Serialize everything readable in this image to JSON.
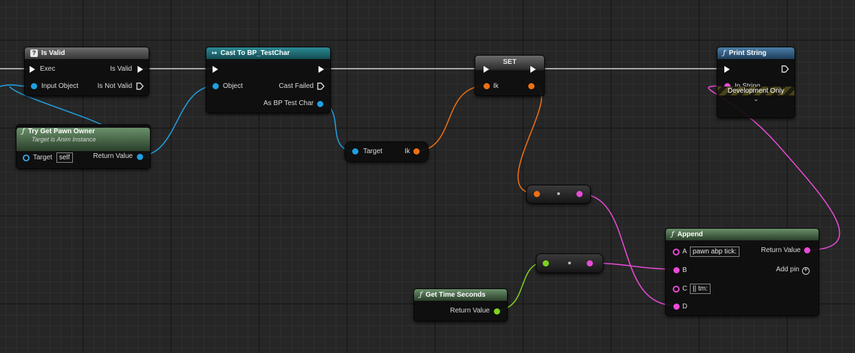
{
  "colors": {
    "exec": "#ffffff",
    "object": "#0ea3e6",
    "float": "#ee6a12",
    "string": "#f24bd6",
    "time": "#7ed321",
    "self": "#3aa0e0"
  },
  "nodes": {
    "is_valid": {
      "title": "Is Valid",
      "exec": "Exec",
      "is_valid": "Is Valid",
      "input_object": "Input Object",
      "is_not_valid": "Is Not Valid"
    },
    "cast": {
      "title": "Cast To BP_TestChar",
      "object": "Object",
      "cast_failed": "Cast Failed",
      "as_bp": "As BP Test Char"
    },
    "set": {
      "title": "SET",
      "ik": "Ik"
    },
    "print_string": {
      "title": "Print String",
      "in_string": "In String",
      "dev_only": "Development Only"
    },
    "try_get_pawn_owner": {
      "title": "Try Get Pawn Owner",
      "subtitle": "Target is Anim Instance",
      "target": "Target",
      "target_value": "self",
      "return_value": "Return Value"
    },
    "target_ik": {
      "target": "Target",
      "ik": "Ik"
    },
    "append": {
      "title": "Append",
      "a": "A",
      "a_value": "pawn abp tick:",
      "b": "B",
      "return_value": "Return Value",
      "add_pin": "Add pin",
      "c": "C",
      "c_value": "|| tm:",
      "d": "D"
    },
    "get_time": {
      "title": "Get Time Seconds",
      "return_value": "Return Value"
    }
  }
}
